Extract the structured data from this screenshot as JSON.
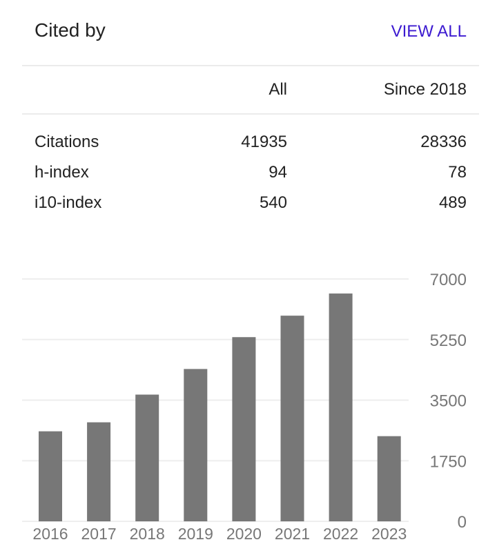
{
  "header": {
    "title": "Cited by",
    "view_all": "VIEW ALL"
  },
  "table": {
    "columns": [
      "All",
      "Since 2018"
    ],
    "rows": [
      {
        "label": "Citations",
        "all": "41935",
        "since": "28336"
      },
      {
        "label": "h-index",
        "all": "94",
        "since": "78"
      },
      {
        "label": "i10-index",
        "all": "540",
        "since": "489"
      }
    ]
  },
  "colors": {
    "link": "#3c1ad0",
    "bar": "#777777",
    "grid": "#eeeeee"
  },
  "chart_data": {
    "type": "bar",
    "title": "",
    "xlabel": "",
    "ylabel": "",
    "categories": [
      "2016",
      "2017",
      "2018",
      "2019",
      "2020",
      "2021",
      "2022",
      "2023"
    ],
    "values": [
      2600,
      2860,
      3660,
      4400,
      5320,
      5940,
      6580,
      2460
    ],
    "ylim": [
      0,
      7000
    ],
    "yticks": [
      0,
      1750,
      3500,
      5250,
      7000
    ],
    "y_axis_side": "right",
    "grid": true
  }
}
